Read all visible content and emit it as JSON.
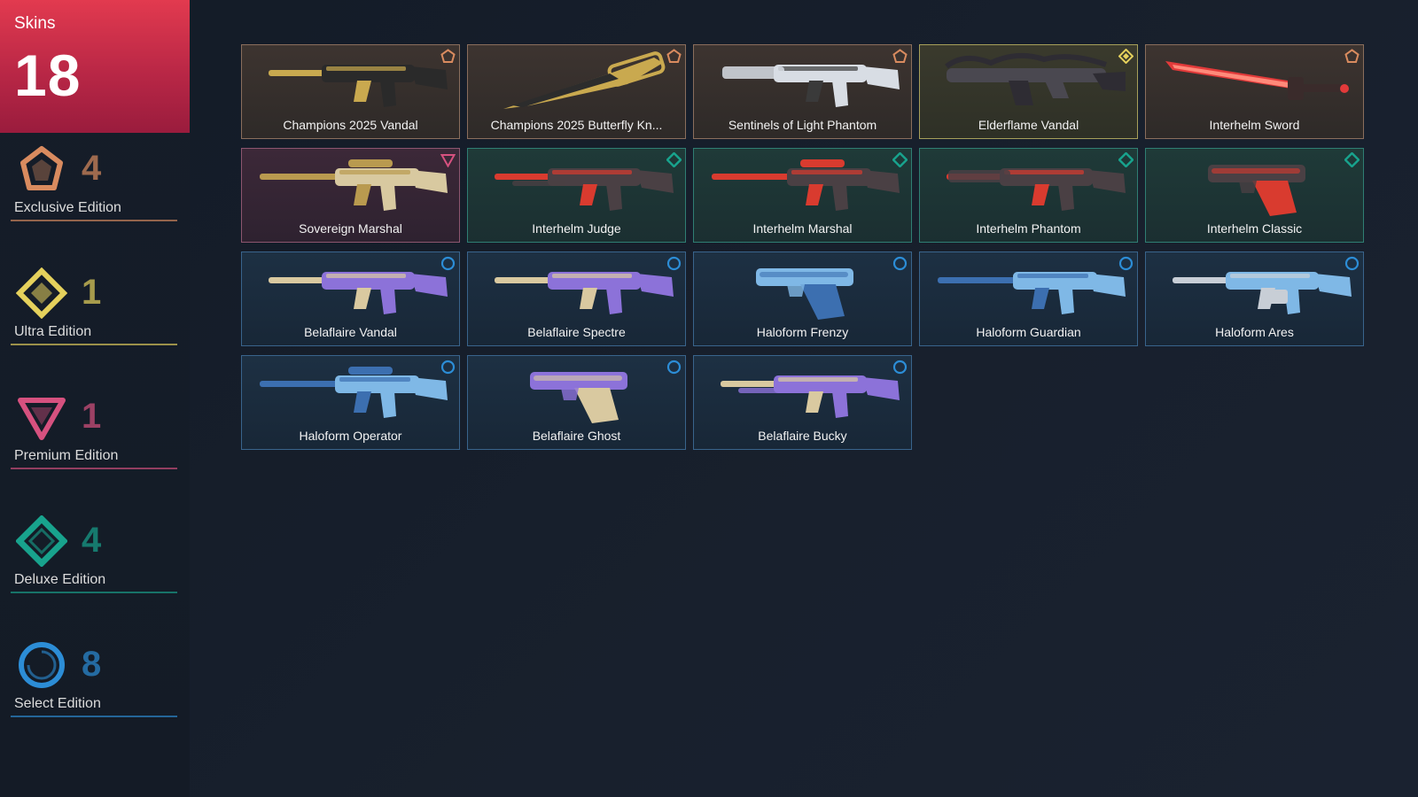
{
  "sidebar": {
    "total": {
      "label": "Skins",
      "count": "18"
    },
    "tiers": [
      {
        "key": "exclusive",
        "name": "Exclusive Edition",
        "count": "4",
        "color": "#d98b5f",
        "icon": "exclusive-pentagon-icon"
      },
      {
        "key": "ultra",
        "name": "Ultra Edition",
        "count": "1",
        "color": "#e5d15c",
        "icon": "ultra-diamond-icon"
      },
      {
        "key": "premium",
        "name": "Premium Edition",
        "count": "1",
        "color": "#d6517f",
        "icon": "premium-triangle-icon"
      },
      {
        "key": "deluxe",
        "name": "Deluxe Edition",
        "count": "4",
        "color": "#18a38d",
        "icon": "deluxe-diamond-icon"
      },
      {
        "key": "select",
        "name": "Select Edition",
        "count": "8",
        "color": "#2c8dd6",
        "icon": "select-ring-icon"
      }
    ]
  },
  "skins": [
    {
      "name": "Champions 2025 Vandal",
      "tier": "exclusive",
      "weapon": "rifle",
      "colors": [
        "#2a2a2a",
        "#c9a94f"
      ]
    },
    {
      "name": "Champions 2025 Butterfly Kn...",
      "tier": "exclusive",
      "weapon": "knife",
      "colors": [
        "#2c2c2c",
        "#c9a94f"
      ]
    },
    {
      "name": "Sentinels of Light Phantom",
      "tier": "exclusive",
      "weapon": "phantom",
      "colors": [
        "#d8dde4",
        "#3a3a3a"
      ]
    },
    {
      "name": "Elderflame Vandal",
      "tier": "ultra",
      "weapon": "dragon",
      "colors": [
        "#4a4850",
        "#2e2c33"
      ]
    },
    {
      "name": "Interhelm Sword",
      "tier": "exclusive",
      "weapon": "sword",
      "colors": [
        "#e23a3a",
        "#3a2b2b"
      ]
    },
    {
      "name": "Sovereign Marshal",
      "tier": "premium",
      "weapon": "sniper",
      "colors": [
        "#d8c9a0",
        "#b99a4f"
      ]
    },
    {
      "name": "Interhelm Judge",
      "tier": "deluxe",
      "weapon": "shotgun",
      "colors": [
        "#4a4044",
        "#d93b2f"
      ]
    },
    {
      "name": "Interhelm Marshal",
      "tier": "deluxe",
      "weapon": "sniper",
      "colors": [
        "#4a4044",
        "#d93b2f"
      ]
    },
    {
      "name": "Interhelm Phantom",
      "tier": "deluxe",
      "weapon": "phantom",
      "colors": [
        "#4a4044",
        "#d93b2f"
      ]
    },
    {
      "name": "Interhelm Classic",
      "tier": "deluxe",
      "weapon": "pistol",
      "colors": [
        "#4a4044",
        "#d93b2f"
      ]
    },
    {
      "name": "Belaflaire Vandal",
      "tier": "select",
      "weapon": "rifle",
      "colors": [
        "#8c72d9",
        "#d9c9a0"
      ]
    },
    {
      "name": "Belaflaire Spectre",
      "tier": "select",
      "weapon": "smg",
      "colors": [
        "#8c72d9",
        "#d9c9a0"
      ]
    },
    {
      "name": "Haloform Frenzy",
      "tier": "select",
      "weapon": "pistol",
      "colors": [
        "#7fb8e6",
        "#3c6fb0"
      ]
    },
    {
      "name": "Haloform Guardian",
      "tier": "select",
      "weapon": "rifle-long",
      "colors": [
        "#7fb8e6",
        "#3c6fb0"
      ]
    },
    {
      "name": "Haloform Ares",
      "tier": "select",
      "weapon": "lmg",
      "colors": [
        "#7fb8e6",
        "#c8ced6"
      ]
    },
    {
      "name": "Haloform Operator",
      "tier": "select",
      "weapon": "sniper",
      "colors": [
        "#7fb8e6",
        "#3c6fb0"
      ]
    },
    {
      "name": "Belaflaire Ghost",
      "tier": "select",
      "weapon": "pistol",
      "colors": [
        "#8c72d9",
        "#d9c9a0"
      ]
    },
    {
      "name": "Belaflaire Bucky",
      "tier": "select",
      "weapon": "shotgun",
      "colors": [
        "#8c72d9",
        "#d9c9a0"
      ]
    }
  ]
}
